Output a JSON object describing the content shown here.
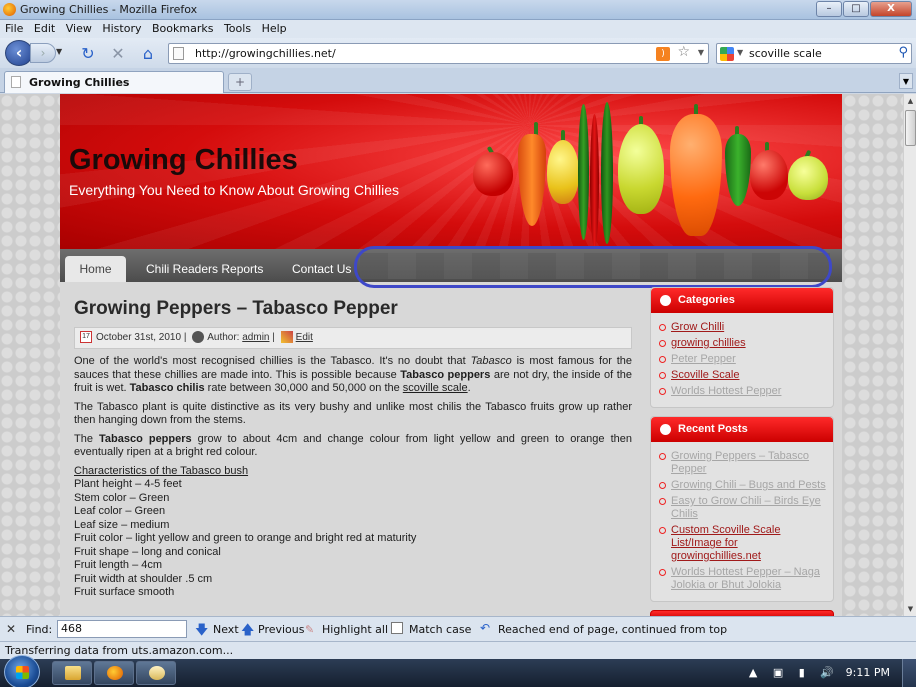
{
  "window": {
    "title": "Growing Chillies - Mozilla Firefox",
    "minimize": "–",
    "maximize": "□",
    "close": "X"
  },
  "menubar": {
    "items": [
      "File",
      "Edit",
      "View",
      "History",
      "Bookmarks",
      "Tools",
      "Help"
    ]
  },
  "navbar": {
    "url": "http://growingchillies.net/",
    "search_value": "scoville scale"
  },
  "tabs": [
    {
      "title": "Growing Chillies"
    }
  ],
  "site": {
    "title": "Growing Chillies",
    "tagline": "Everything You Need to Know About Growing Chillies",
    "menu": [
      "Home",
      "Chili Readers Reports",
      "Contact Us"
    ]
  },
  "post": {
    "title": "Growing Peppers – Tabasco Pepper",
    "date": "October 31st, 2010",
    "author_label": "Author:",
    "author": "admin",
    "edit": "Edit",
    "p1_a": "One of the world's most recognised chillies is the Tabasco. It's no doubt that ",
    "p1_b": "Tabasco",
    "p1_c": " is most famous for the sauces that these chillies are made into. This is possible because ",
    "p1_d": "Tabasco peppers",
    "p1_e": " are not dry, the inside of the fruit is wet. ",
    "p1_f": "Tabasco chilis",
    "p1_g": " rate between 30,000 and 50,000 on the ",
    "p1_link": "scoville scale",
    "p1_h": ".",
    "p2": "The Tabasco plant is quite distinctive as its very bushy and unlike most chilis the Tabasco fruits grow up rather then hanging down from the stems.",
    "p3_a": "The ",
    "p3_b": "Tabasco peppers",
    "p3_c": " grow to about 4cm and change colour from light yellow and green to orange then eventually ripen at a bright red colour.",
    "list_heading": "Characteristics of the Tabasco bush",
    "list": [
      "Plant height – 4-5 feet",
      "Stem color – Green",
      "Leaf color – Green",
      "Leaf size – medium",
      "Fruit color – light yellow and green to orange and bright red at maturity",
      "Fruit shape – long and conical",
      "Fruit length – 4cm",
      "Fruit width at shoulder .5 cm",
      "Fruit surface smooth"
    ]
  },
  "sidebar": {
    "categories_title": "Categories",
    "categories": [
      {
        "label": "Grow Chilli",
        "faded": false
      },
      {
        "label": "growing chillies",
        "faded": false
      },
      {
        "label": "Peter Pepper",
        "faded": true
      },
      {
        "label": "Scoville Scale",
        "faded": false
      },
      {
        "label": "Worlds Hottest Pepper",
        "faded": true
      }
    ],
    "recent_title": "Recent Posts",
    "recent": [
      {
        "label": "Growing Peppers – Tabasco Pepper",
        "faded": true
      },
      {
        "label": "Growing Chili – Bugs and Pests",
        "faded": true
      },
      {
        "label": "Easy to Grow Chili – Birds Eye Chilis",
        "faded": true
      },
      {
        "label": "Custom Scoville Scale List/Image for growingchillies.net",
        "faded": false
      },
      {
        "label": "Worlds Hottest Pepper – Naga Jolokia or Bhut Jolokia",
        "faded": true
      }
    ]
  },
  "findbar": {
    "label": "Find:",
    "value": "468",
    "next": "Next",
    "previous": "Previous",
    "highlight_all": "Highlight all",
    "match_case": "Match case",
    "status": "Reached end of page, continued from top"
  },
  "statusbar": {
    "text": "Transferring data from uts.amazon.com..."
  },
  "taskbar": {
    "clock": "9:11 PM"
  },
  "colors": {
    "accent_red": "#d40c0c",
    "highlight_oval": "#3e48c8",
    "link_red": "#a01a1a"
  }
}
